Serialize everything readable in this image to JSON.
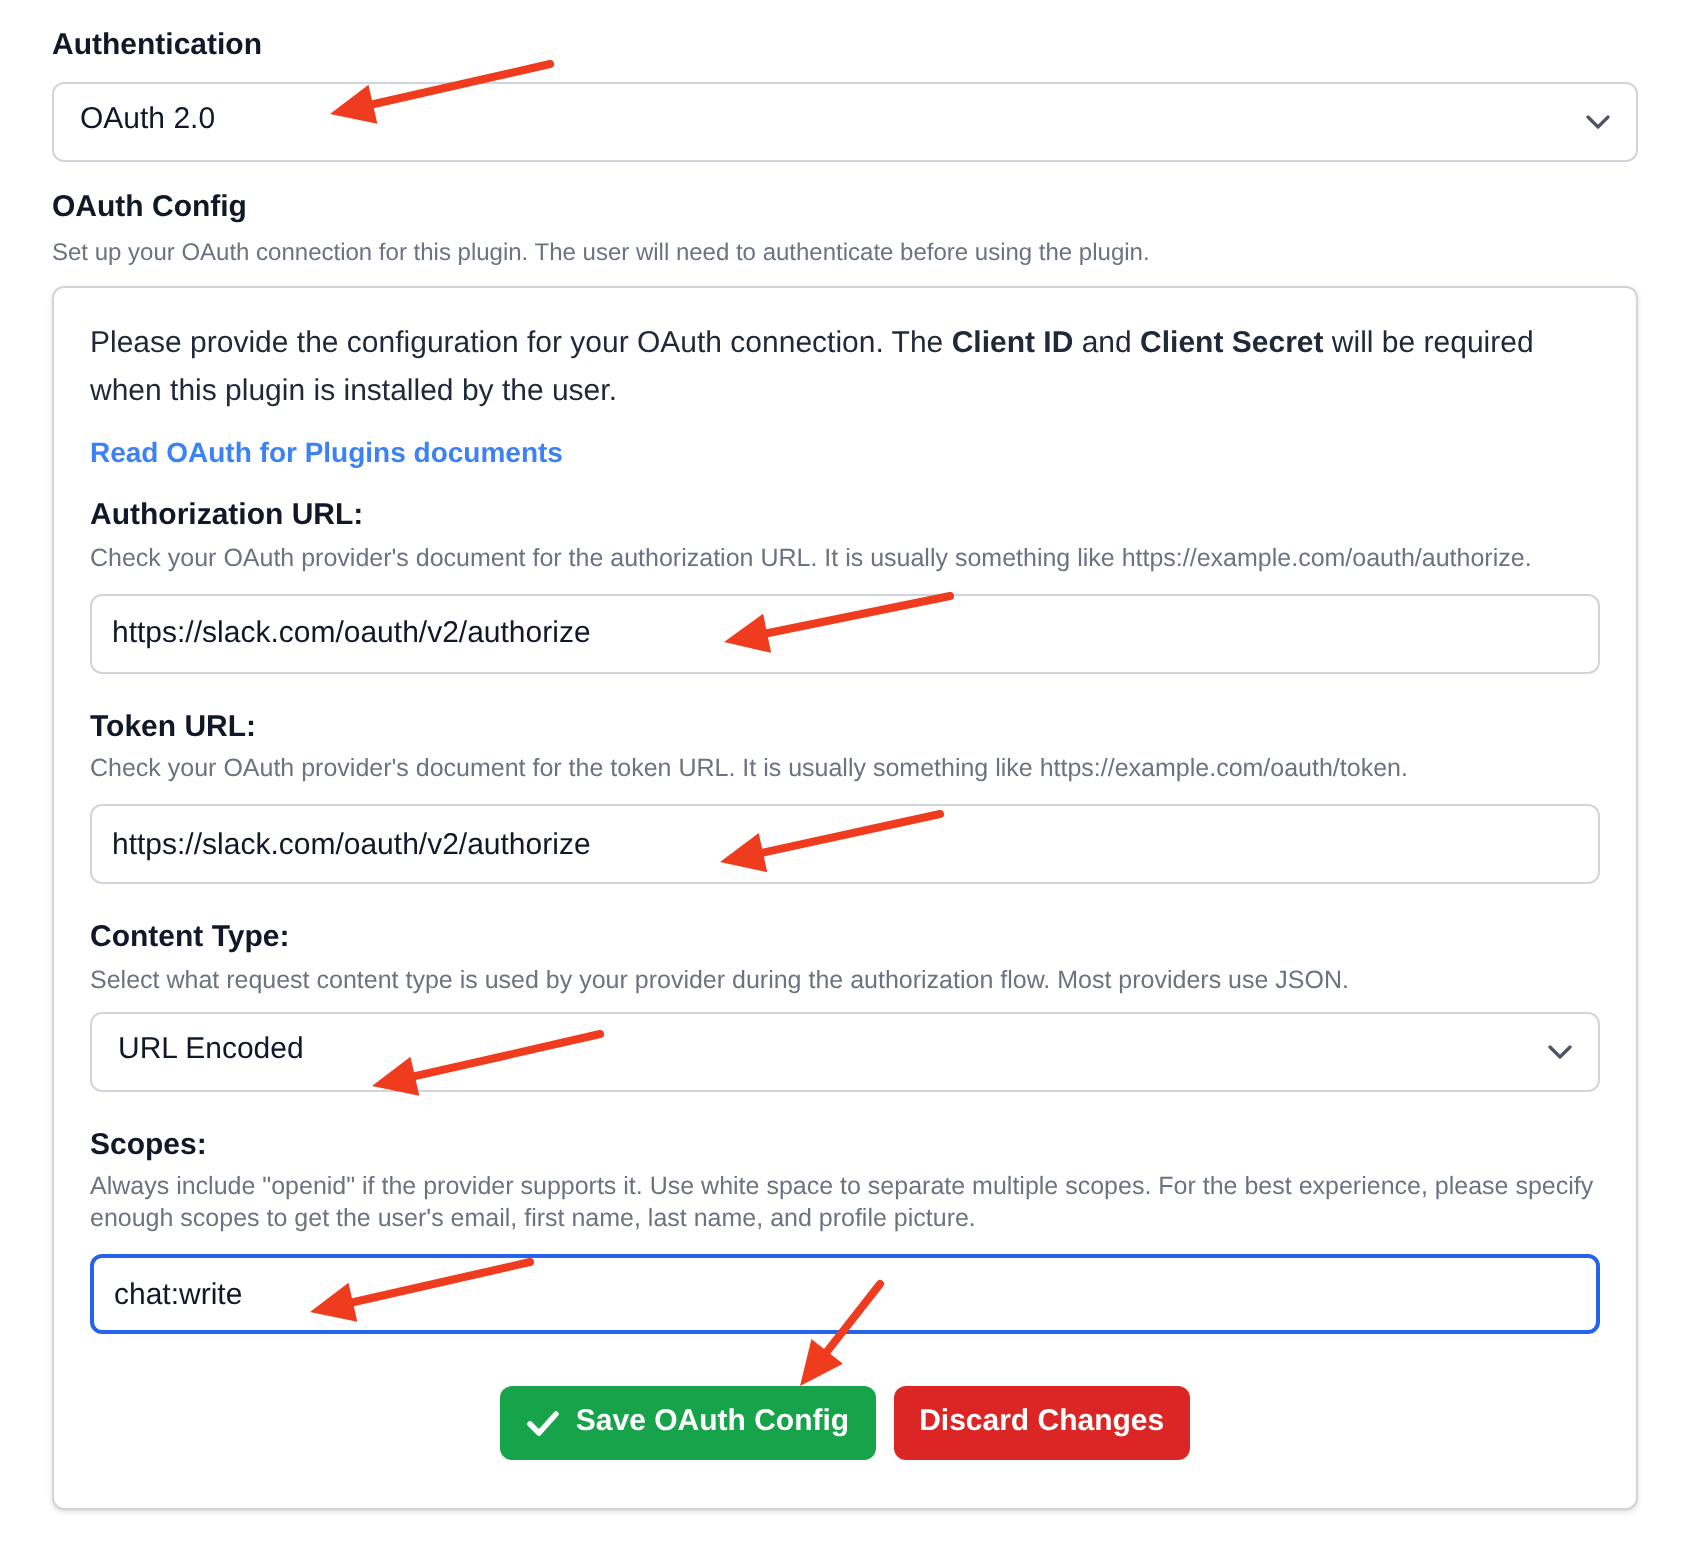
{
  "authentication": {
    "label": "Authentication",
    "value": "OAuth 2.0"
  },
  "oauth_config": {
    "title": "OAuth Config",
    "subtitle": "Set up your OAuth connection for this plugin. The user will need to authenticate before using the plugin.",
    "intro": "Please provide the configuration for your OAuth connection. The **Client ID** and **Client Secret** will be required when this plugin is installed by the user.",
    "link": "Read OAuth for Plugins documents",
    "fields": [
      {
        "kind": "text",
        "label": "Authorization URL:",
        "hint": "Check your OAuth provider's document for the authorization URL. It is usually something like https://example.com/oauth/authorize.",
        "value": "https://slack.com/oauth/v2/authorize",
        "focused": false
      },
      {
        "kind": "text",
        "label": "Token URL:",
        "hint": "Check your OAuth provider's document for the token URL. It is usually something like https://example.com/oauth/token.",
        "value": "https://slack.com/oauth/v2/authorize",
        "focused": false
      },
      {
        "kind": "select",
        "label": "Content Type:",
        "hint": "Select what request content type is used by your provider during the authorization flow. Most providers use JSON.",
        "value": "URL Encoded",
        "focused": false
      },
      {
        "kind": "text",
        "label": "Scopes:",
        "hint": "Always include \"openid\" if the provider supports it. Use white space to separate multiple scopes. For the best experience, please specify enough scopes to get the user's email, first name, last name, and profile picture.",
        "value": "chat:write",
        "focused": true
      }
    ],
    "buttons": [
      {
        "kind": "save",
        "label": "Save OAuth Config"
      },
      {
        "kind": "discard",
        "label": "Discard Changes"
      }
    ]
  }
}
